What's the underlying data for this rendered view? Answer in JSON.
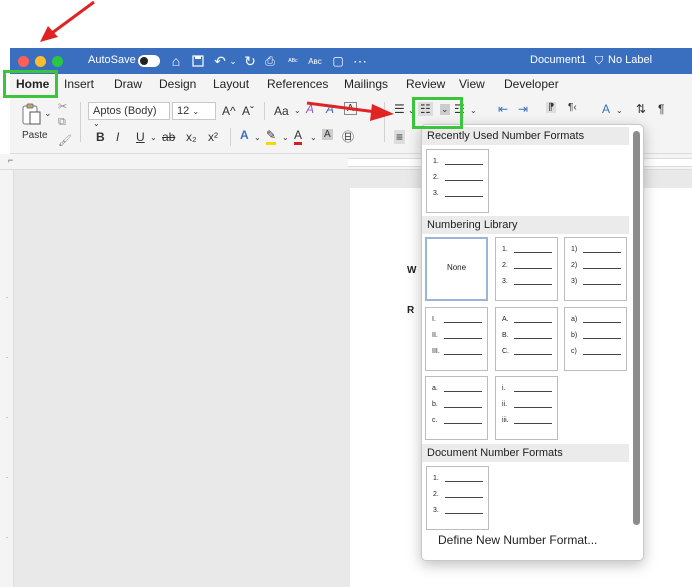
{
  "titlebar": {
    "autosave_label": "AutoSave",
    "document_title": "Document1",
    "label_status": "No Label",
    "more_icon": "ellipsis-icon"
  },
  "tabs": [
    "Home",
    "Insert",
    "Draw",
    "Design",
    "Layout",
    "References",
    "Mailings",
    "Review",
    "View",
    "Developer"
  ],
  "ribbon": {
    "paste_label": "Paste",
    "font_name": "Aptos (Body)",
    "font_size": "12",
    "grow_font": "A^",
    "shrink_font": "Aˇ",
    "change_case": "Aa",
    "bold": "B",
    "italic": "I",
    "underline": "U",
    "strikethrough": "ab",
    "subscript": "x₂",
    "superscript": "x²",
    "sort_icon": "sort-az-icon"
  },
  "numbering_menu": {
    "recent_header": "Recently Used Number Formats",
    "recent_formats": [
      {
        "labels": [
          "1.",
          "2.",
          "3."
        ]
      }
    ],
    "library_header": "Numbering Library",
    "library_formats": [
      {
        "none_label": "None",
        "labels": []
      },
      {
        "labels": [
          "1.",
          "2.",
          "3."
        ]
      },
      {
        "labels": [
          "1)",
          "2)",
          "3)"
        ]
      },
      {
        "labels": [
          "I.",
          "II.",
          "III."
        ]
      },
      {
        "labels": [
          "A.",
          "B.",
          "C."
        ]
      },
      {
        "labels": [
          "a)",
          "b)",
          "c)"
        ]
      },
      {
        "labels": [
          "a.",
          "b.",
          "c."
        ]
      },
      {
        "labels": [
          "i.",
          "ii.",
          "iii."
        ]
      }
    ],
    "document_header": "Document Number Formats",
    "document_formats": [
      {
        "labels": [
          "1.",
          "2.",
          "3."
        ]
      }
    ],
    "define_label": "Define New Number Format..."
  },
  "document": {
    "visible_letters": [
      "W",
      "R"
    ]
  },
  "colors": {
    "titlebar": "#3a6fc0",
    "highlight": "#3cc43c",
    "annotation_arrow": "#e02424"
  }
}
